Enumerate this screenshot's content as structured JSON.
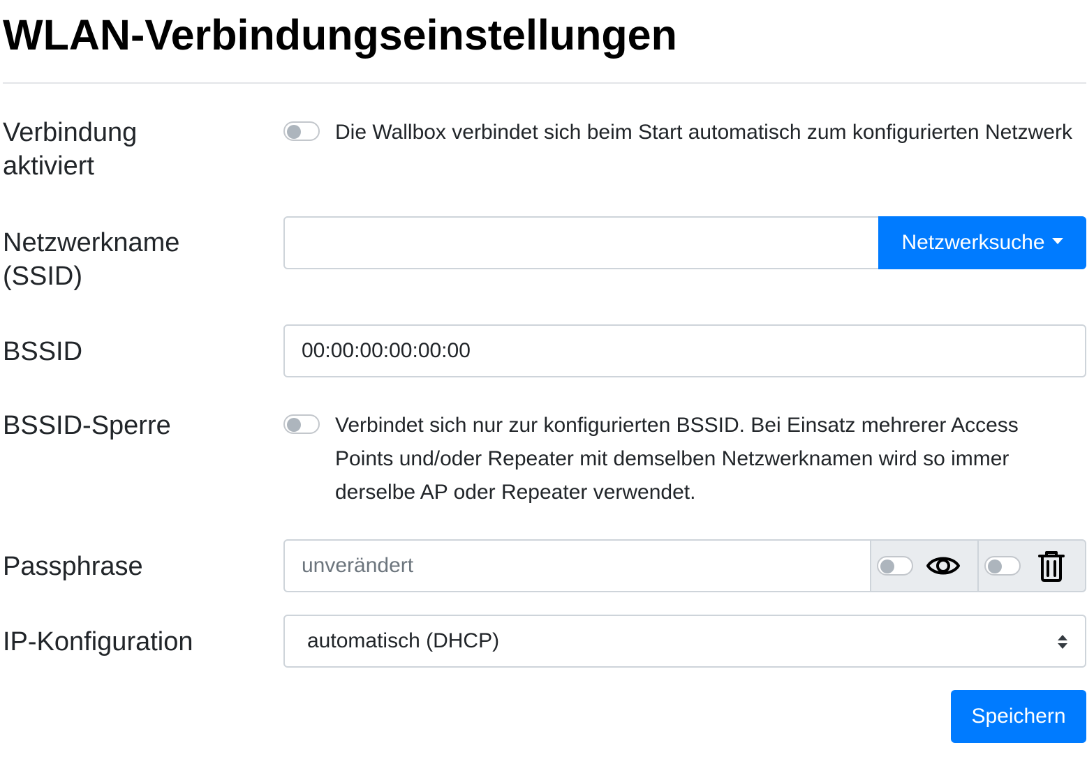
{
  "page": {
    "title": "WLAN-Verbindungseinstellungen"
  },
  "form": {
    "enabled": {
      "label": "Verbindung aktiviert",
      "checked": false,
      "description": "Die Wallbox verbindet sich beim Start automatisch zum konfigurierten Netzwerk"
    },
    "ssid": {
      "label": "Netzwerkname (SSID)",
      "value": "",
      "scan_button": "Netzwerksuche",
      "scan_icon": "caret-down-icon"
    },
    "bssid": {
      "label": "BSSID",
      "value": "00:00:00:00:00:00"
    },
    "bssid_lock": {
      "label": "BSSID-Sperre",
      "checked": false,
      "description": "Verbindet sich nur zur konfigurierten BSSID. Bei Einsatz mehrerer Access Points und/oder Repeater mit demselben Netzwerknamen wird so immer derselbe AP oder Repeater verwendet."
    },
    "passphrase": {
      "label": "Passphrase",
      "value": "",
      "placeholder": "unverändert",
      "show_toggle_checked": false,
      "show_icon": "eye-icon",
      "clear_toggle_checked": false,
      "clear_icon": "trash-icon"
    },
    "ip_config": {
      "label": "IP-Konfiguration",
      "selected": "automatisch (DHCP)"
    },
    "save_button": "Speichern"
  },
  "colors": {
    "primary": "#007bff",
    "addon_bg": "#e9ecef",
    "border": "#ced4da",
    "switch_knob": "#adb5bd"
  }
}
